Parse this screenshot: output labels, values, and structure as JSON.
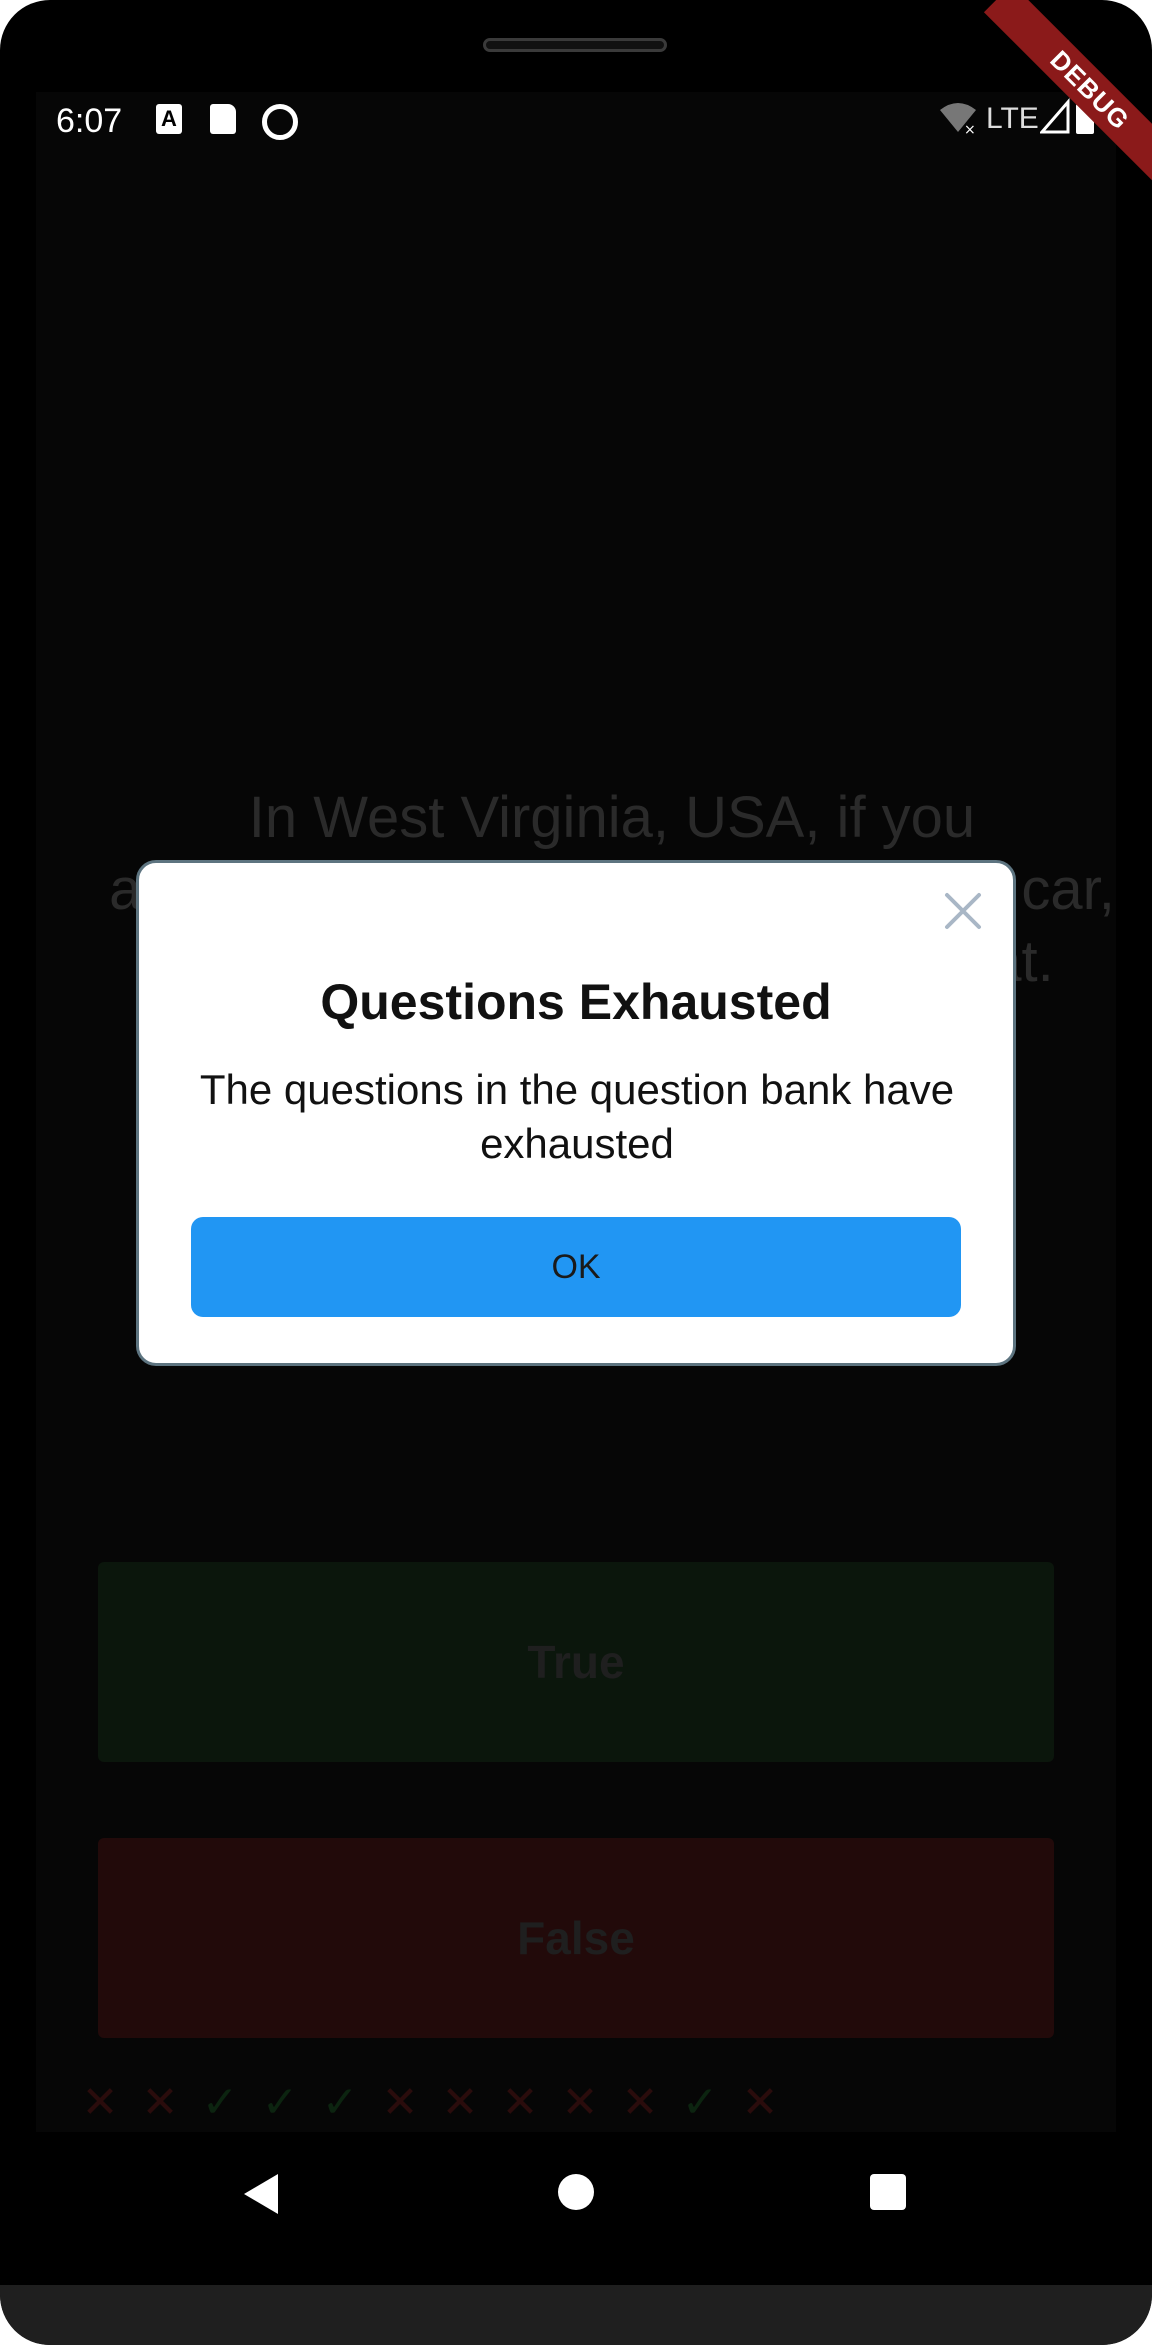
{
  "status_bar": {
    "time": "6:07",
    "network": "LTE",
    "icons": [
      "a-icon",
      "sd-card-icon",
      "rotation-lock-icon",
      "wifi-off-icon",
      "signal-icon",
      "battery-icon"
    ]
  },
  "debug_banner": "DEBUG",
  "quiz": {
    "question": "In West Virginia, USA, if you accidentally hit an animal with your car, you are free to take it home to eat.",
    "true_label": "True",
    "false_label": "False",
    "score_marks": [
      "x",
      "x",
      "check",
      "check",
      "check",
      "x",
      "x",
      "x",
      "x",
      "x",
      "check",
      "x"
    ]
  },
  "dialog": {
    "title": "Questions Exhausted",
    "body": "The questions in the question bank have exhausted",
    "ok_label": "OK"
  },
  "nav_bar": {
    "icons": [
      "back-icon",
      "home-icon",
      "recents-icon"
    ]
  },
  "colors": {
    "ok_button": "#2196f3",
    "debug_banner": "#8b1a1a",
    "true_button": "#0b160c",
    "false_button": "#220a0a"
  }
}
